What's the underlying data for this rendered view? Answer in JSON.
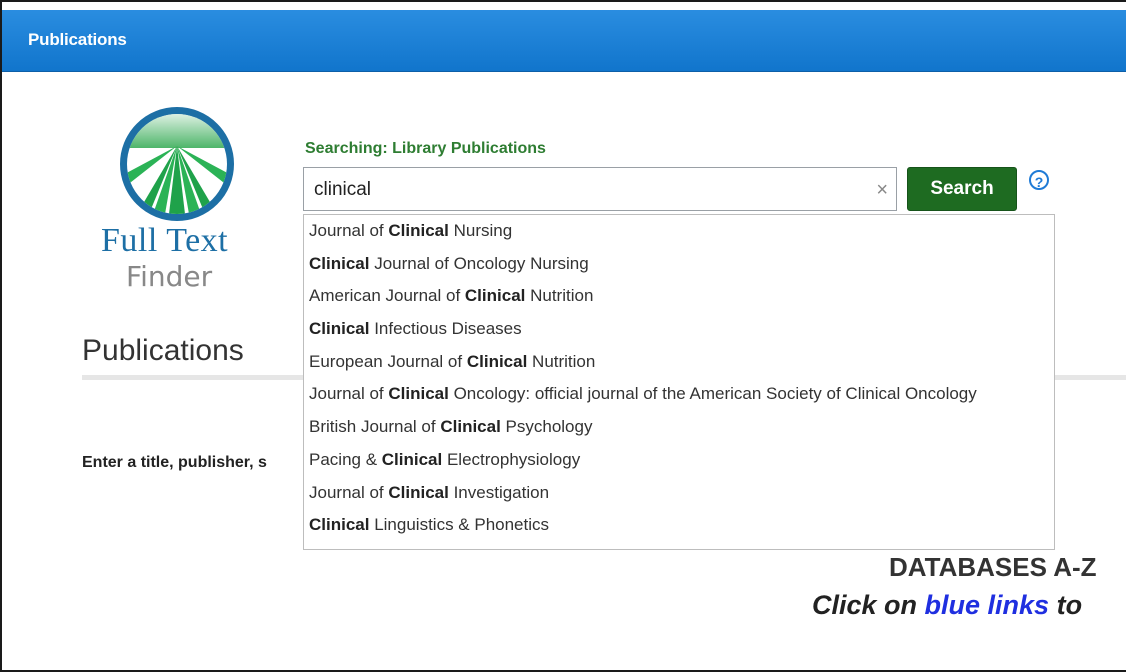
{
  "header": {
    "title": "Publications"
  },
  "logo": {
    "line1": "Full Text",
    "line2": "Finder"
  },
  "search": {
    "searching_label": "Searching: Library Publications",
    "query": "clinical",
    "clear_glyph": "×",
    "button_label": "Search",
    "help_glyph": "?"
  },
  "page": {
    "heading": "Publications",
    "instruction": "Enter a title, publisher, s"
  },
  "suggestions": [
    {
      "before": "Journal of ",
      "match": "Clinical",
      "after": " Nursing"
    },
    {
      "before": "",
      "match": "Clinical",
      "after": " Journal of Oncology Nursing"
    },
    {
      "before": "American Journal of ",
      "match": "Clinical",
      "after": " Nutrition"
    },
    {
      "before": "",
      "match": "Clinical",
      "after": " Infectious Diseases"
    },
    {
      "before": "European Journal of ",
      "match": "Clinical",
      "after": " Nutrition"
    },
    {
      "before": "Journal of ",
      "match": "Clinical",
      "after": " Oncology: official journal of the American Society of Clinical Oncology"
    },
    {
      "before": "British Journal of ",
      "match": "Clinical",
      "after": " Psychology"
    },
    {
      "before": "Pacing & ",
      "match": "Clinical",
      "after": " Electrophysiology"
    },
    {
      "before": "Journal of ",
      "match": "Clinical",
      "after": " Investigation"
    },
    {
      "before": "",
      "match": "Clinical",
      "after": " Linguistics & Phonetics"
    }
  ],
  "databases": {
    "title": "DATABASES A-Z",
    "sub_before": "Click on ",
    "sub_link": "blue links",
    "sub_after": " to"
  },
  "colors": {
    "header_blue": "#1a82d8",
    "search_green": "#1e6b21",
    "label_green": "#2e7d32",
    "link_blue": "#1f2fe0"
  }
}
